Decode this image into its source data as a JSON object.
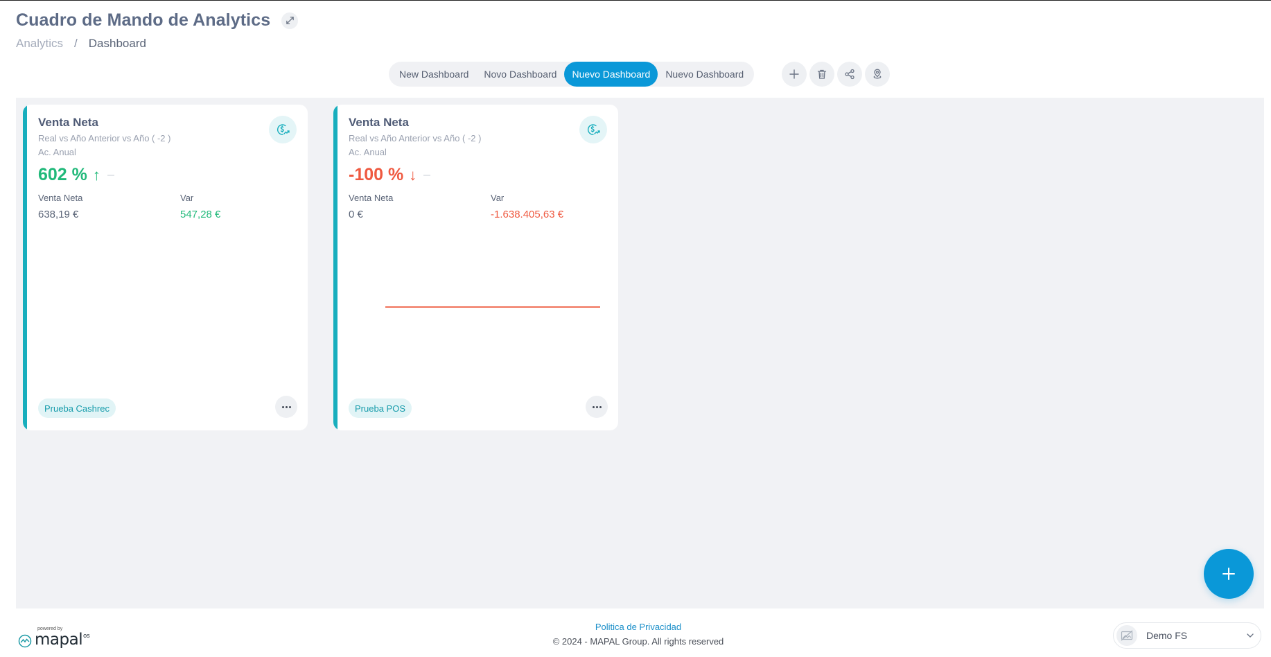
{
  "header": {
    "title": "Cuadro de Mando de Analytics",
    "breadcrumb": {
      "root": "Analytics",
      "separator": "/",
      "current": "Dashboard"
    }
  },
  "dashboard_tabs": [
    {
      "label": "New Dashboard",
      "active": false
    },
    {
      "label": "Novo Dashboard",
      "active": false
    },
    {
      "label": "Nuevo Dashboard",
      "active": true
    },
    {
      "label": "Nuevo Dashboard",
      "active": false
    }
  ],
  "toolbar_icons": [
    "plus-icon",
    "trash-icon",
    "share-icon",
    "location-pin-icon"
  ],
  "cards": [
    {
      "title": "Venta Neta",
      "subtitle": "Real vs Año Anterior vs Año ( -2 )",
      "period": "Ac. Anual",
      "kpi": "602 %",
      "arrow": "↑",
      "trend": "up",
      "metric1_label": "Venta Neta",
      "metric1_value": "638,19 €",
      "metric2_label": "Var",
      "metric2_value": "547,28 €",
      "tag": "Prueba Cashrec"
    },
    {
      "title": "Venta Neta",
      "subtitle": "Real vs Año Anterior vs Año ( -2 )",
      "period": "Ac. Anual",
      "kpi": "-100 %",
      "arrow": "↓",
      "trend": "down",
      "metric1_label": "Venta Neta",
      "metric1_value": "0 €",
      "metric2_label": "Var",
      "metric2_value": "-1.638.405,63 €",
      "tag": "Prueba POS"
    }
  ],
  "footer": {
    "powered_by": "powered by",
    "brand": "mapal",
    "brand_suffix": "os",
    "privacy_link": "Politica de Privacidad",
    "copyright": "© 2024 - MAPAL Group. All rights reserved"
  },
  "org_selector": {
    "value": "Demo FS"
  },
  "colors": {
    "accent": "#0a98d8",
    "teal": "#18aebd",
    "positive": "#21b97a",
    "negative": "#ef5a41",
    "title": "#5d6b86"
  }
}
